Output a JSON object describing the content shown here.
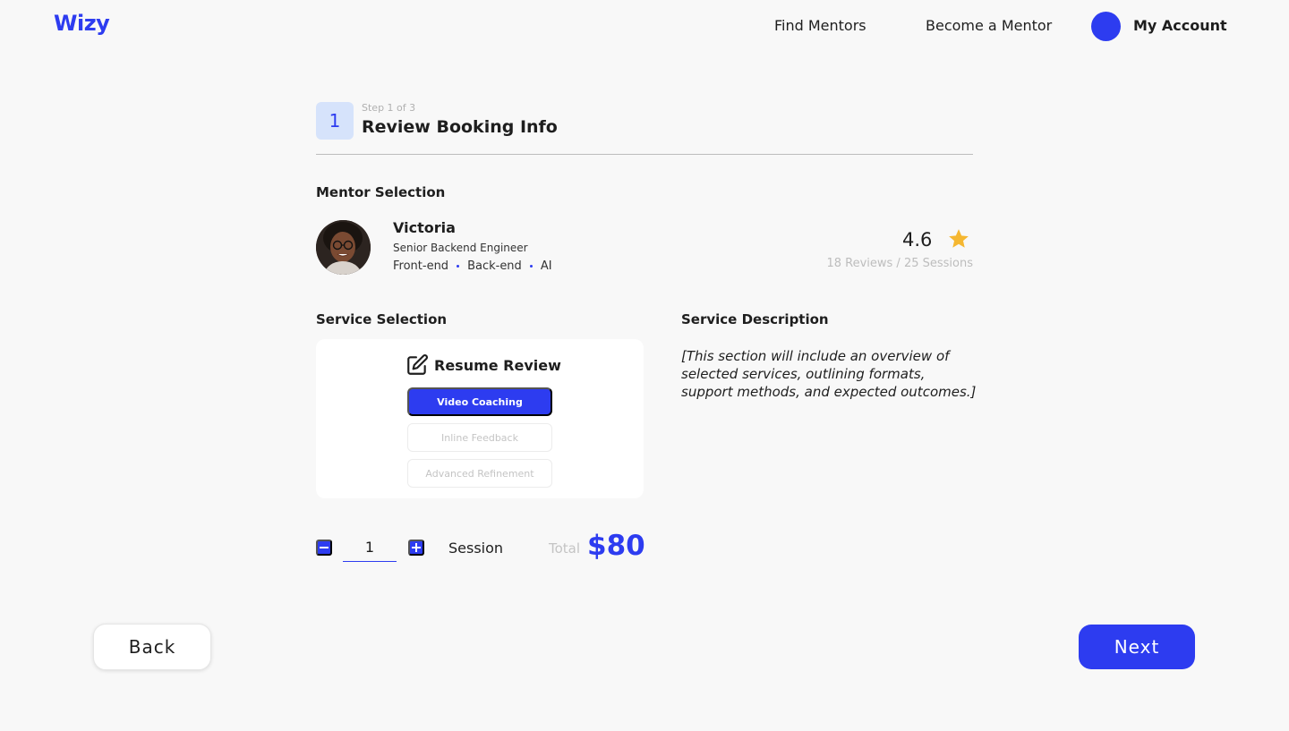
{
  "header": {
    "logo": "Wizy",
    "nav": {
      "find_mentors": "Find Mentors",
      "become_mentor": "Become a Mentor",
      "my_account": "My Account"
    }
  },
  "step": {
    "number": "1",
    "counter": "Step 1 of 3",
    "title": "Review Booking Info"
  },
  "mentor_section": {
    "title": "Mentor Selection",
    "name": "Victoria",
    "role": "Senior Backend Engineer",
    "tags": [
      "Front-end",
      "Back-end",
      "AI"
    ],
    "rating": "4.6",
    "reviews_sessions": "18 Reviews / 25 Sessions"
  },
  "service_section": {
    "title": "Service Selection",
    "service_name": "Resume Review",
    "options": [
      "Video Coaching",
      "Inline Feedback",
      "Advanced Refinement"
    ],
    "selected_option": "Video Coaching"
  },
  "description_section": {
    "title": "Service Description",
    "text": "[This section will include an overview of selected services, outlining formats, support methods, and expected outcomes.]"
  },
  "quantity": {
    "value": "1",
    "unit_label": "Session",
    "total_label": "Total",
    "total_value": "$80"
  },
  "footer": {
    "back_label": "Back",
    "next_label": "Next"
  },
  "colors": {
    "accent": "#2d3cf0",
    "star": "#f5b731",
    "background": "#f8f8f8"
  }
}
